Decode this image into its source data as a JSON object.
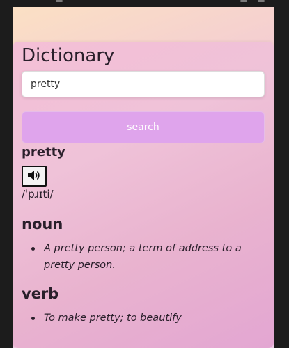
{
  "app": {
    "title": "Dictionary"
  },
  "search": {
    "value": "pretty",
    "button_label": "search"
  },
  "result": {
    "word": "pretty",
    "audio_icon": "speaker-icon",
    "phonetic": "/ˈpɹɪti/",
    "meanings": [
      {
        "part_of_speech": "noun",
        "definitions": [
          "A pretty person; a term of address to a pretty person."
        ]
      },
      {
        "part_of_speech": "verb",
        "definitions": [
          "To make pretty; to beautify"
        ]
      }
    ]
  },
  "colors": {
    "button": "#dfa4ec",
    "text": "#2a1f2b"
  }
}
